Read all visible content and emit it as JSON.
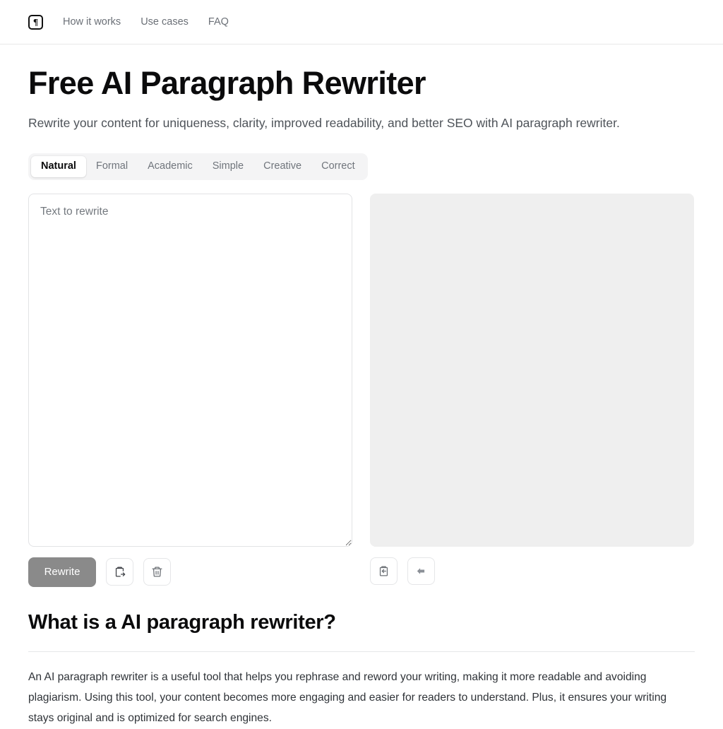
{
  "header": {
    "logo_icon": "pilcrow-icon",
    "nav": [
      {
        "label": "How it works"
      },
      {
        "label": "Use cases"
      },
      {
        "label": "FAQ"
      }
    ]
  },
  "hero": {
    "title": "Free AI Paragraph Rewriter",
    "subtitle": "Rewrite your content for uniqueness, clarity, improved readability, and better SEO with AI paragraph rewriter."
  },
  "tabs": {
    "active_index": 0,
    "items": [
      {
        "label": "Natural"
      },
      {
        "label": "Formal"
      },
      {
        "label": "Academic"
      },
      {
        "label": "Simple"
      },
      {
        "label": "Creative"
      },
      {
        "label": "Correct"
      }
    ]
  },
  "editor": {
    "input": {
      "placeholder": "Text to rewrite",
      "value": ""
    },
    "output": {
      "value": ""
    },
    "left_actions": {
      "rewrite_label": "Rewrite",
      "paste_icon": "clipboard-paste-icon",
      "clear_icon": "trash-icon"
    },
    "right_actions": {
      "copy_icon": "clipboard-copy-icon",
      "replace_icon": "arrow-left-icon"
    }
  },
  "article": {
    "heading": "What is a AI paragraph rewriter?",
    "body": "An AI paragraph rewriter is a useful tool that helps you rephrase and reword your writing, making it more readable and avoiding plagiarism. Using this tool, your content becomes more engaging and easier for readers to understand. Plus, it ensures your writing stays original and is optimized for search engines."
  },
  "colors": {
    "text_primary": "#0b0b0c",
    "text_muted": "#6b7077",
    "primary_button_bg": "#8a8a8a",
    "panel_bg": "#efefef",
    "border": "#e2e3e5"
  }
}
